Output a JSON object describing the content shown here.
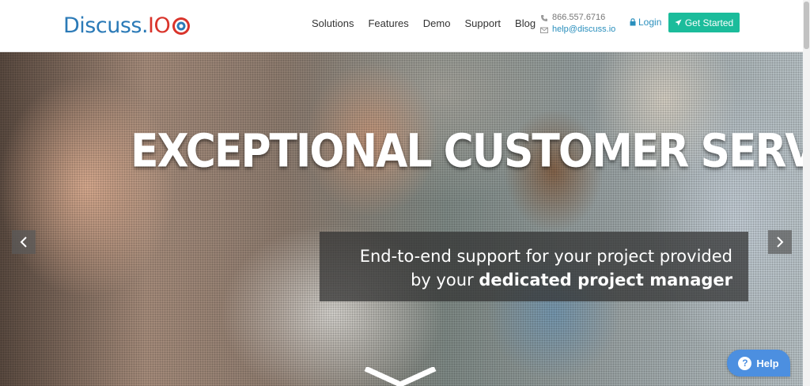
{
  "header": {
    "logo": {
      "text_main": "Discuss.",
      "text_accent": "IO"
    },
    "nav": [
      {
        "label": "Solutions"
      },
      {
        "label": "Features"
      },
      {
        "label": "Demo"
      },
      {
        "label": "Support"
      },
      {
        "label": "Blog"
      }
    ],
    "contact": {
      "phone": "866.557.6716",
      "email": "help@discuss.io"
    },
    "login_label": "Login",
    "cta_label": "Get Started"
  },
  "hero": {
    "headline": "EXCEPTIONAL CUSTOMER SERVICE",
    "subtitle_line1": "End-to-end support for your project provided",
    "subtitle_line2_prefix": "by your ",
    "subtitle_line2_bold": "dedicated project manager"
  },
  "help_label": "Help",
  "colors": {
    "brand_blue": "#2b7ab7",
    "brand_red": "#d9342b",
    "cta_green": "#1bbc9b",
    "link_blue": "#2a8fbd",
    "help_blue": "#4c8fe0"
  },
  "icons": {
    "phone": "phone-icon",
    "email": "envelope-icon",
    "login": "lock-icon",
    "cta": "paper-plane-icon",
    "prev": "chevron-left-icon",
    "next": "chevron-right-icon",
    "scroll": "chevron-down-icon",
    "help": "question-icon"
  }
}
